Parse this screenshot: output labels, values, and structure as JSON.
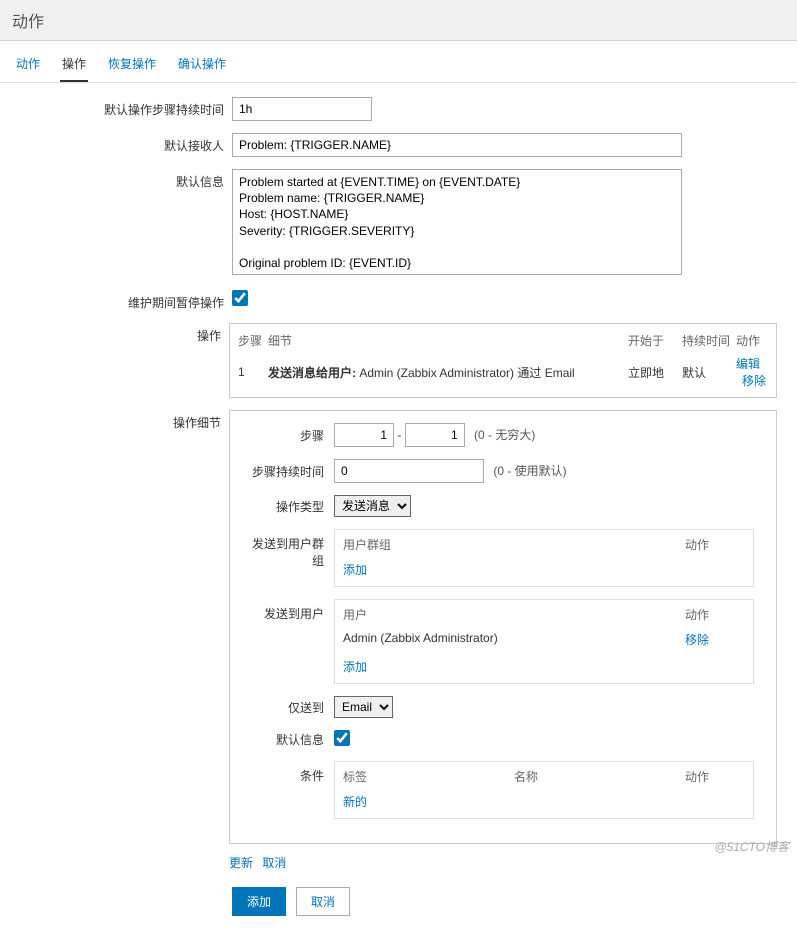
{
  "header": {
    "title": "动作"
  },
  "tabs": {
    "action": "动作",
    "operation": "操作",
    "recovery": "恢复操作",
    "ack": "确认操作"
  },
  "labels": {
    "default_step_duration": "默认操作步骤持续时间",
    "default_recipient": "默认接收人",
    "default_message": "默认信息",
    "pause_maintenance": "维护期间暂停操作",
    "operations": "操作",
    "operation_details": "操作细节"
  },
  "fields": {
    "duration": "1h",
    "recipient": "Problem: {TRIGGER.NAME}",
    "message": "Problem started at {EVENT.TIME} on {EVENT.DATE}\nProblem name: {TRIGGER.NAME}\nHost: {HOST.NAME}\nSeverity: {TRIGGER.SEVERITY}\n\nOriginal problem ID: {EVENT.ID}\n{TRIGGER.URL}",
    "pause_checked": true
  },
  "ops_table": {
    "head_step": "步骤",
    "head_detail": "细节",
    "head_start": "开始于",
    "head_duration": "持续时间",
    "head_action": "动作",
    "row_step": "1",
    "row_bold": "发送消息给用户:",
    "row_text": " Admin (Zabbix Administrator) 通过 Email",
    "row_start": "立即地",
    "row_duration": "默认",
    "edit": "编辑",
    "remove": "移除"
  },
  "detail": {
    "lbl_step": "步骤",
    "step_from": "1",
    "step_to": "1",
    "step_hint": "(0 - 无穷大)",
    "lbl_step_duration": "步骤持续时间",
    "step_duration": "0",
    "step_duration_hint": "(0 - 使用默认)",
    "lbl_op_type": "操作类型",
    "op_type": "发送消息",
    "lbl_send_groups": "发送到用户群组",
    "groups_head1": "用户群组",
    "groups_head2": "动作",
    "groups_add": "添加",
    "lbl_send_users": "发送到用户",
    "users_head1": "用户",
    "users_head2": "动作",
    "users_row": "Admin (Zabbix Administrator)",
    "users_remove": "移除",
    "users_add": "添加",
    "lbl_send_only": "仅送到",
    "send_only": "Email",
    "lbl_default_msg": "默认信息",
    "default_msg_checked": true,
    "lbl_conditions": "条件",
    "cond_head1": "标签",
    "cond_head2": "名称",
    "cond_head3": "动作",
    "cond_new": "新的",
    "update": "更新",
    "cancel": "取消"
  },
  "footer": {
    "add": "添加",
    "cancel": "取消"
  },
  "watermark": "@51CTO博客"
}
